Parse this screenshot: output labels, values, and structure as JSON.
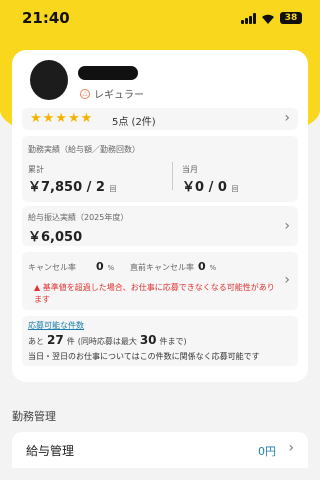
{
  "status_bar": {
    "time": "21:40",
    "battery": "38"
  },
  "profile": {
    "rank": "レギュラー"
  },
  "rating": {
    "stars": "★★★★★",
    "text": "5点 (2件)"
  },
  "work_record": {
    "title": "勤務実績（給与額／勤務回数）",
    "total_label": "累計",
    "total_value": "￥7,850 / 2",
    "total_unit": "回",
    "month_label": "当月",
    "month_value": "￥0 / 0",
    "month_unit": "回"
  },
  "transfer": {
    "title": "給与振込実績（2025年度）",
    "value": "￥6,050"
  },
  "cancel": {
    "rate_label": "キャンセル率",
    "rate_value": "0",
    "rate_unit": "%",
    "recent_label": "直前キャンセル率",
    "recent_value": "0",
    "recent_unit": "%",
    "warning": "基準値を超過した場合、お仕事に応募できなくなる可能性があります"
  },
  "available": {
    "link": "応募可能な件数",
    "prefix": "あと",
    "count": "27",
    "count_unit": "件",
    "paren_left": "(同時応募は最大",
    "max": "30",
    "paren_right": "件まで)",
    "note": "当日・翌日のお仕事についてはこの件数に関係なく応募可能です"
  },
  "management": {
    "section_title": "勤務管理",
    "salary_label": "給与管理",
    "salary_value": "0円"
  }
}
